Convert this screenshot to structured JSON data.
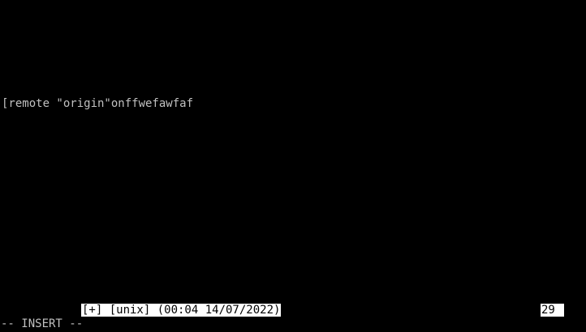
{
  "editor": {
    "buffer_line": "[remote \"origin\"onffwefawfaf"
  },
  "statusline": {
    "info": "[+] [unix] (00:04 14/07/2022)",
    "line_number": "29"
  },
  "mode": {
    "label": "-- INSERT --"
  },
  "colors": {
    "background": "#000000",
    "text": "#c0c0c0",
    "statusline_bg": "#ffffff",
    "statusline_fg": "#000000"
  }
}
